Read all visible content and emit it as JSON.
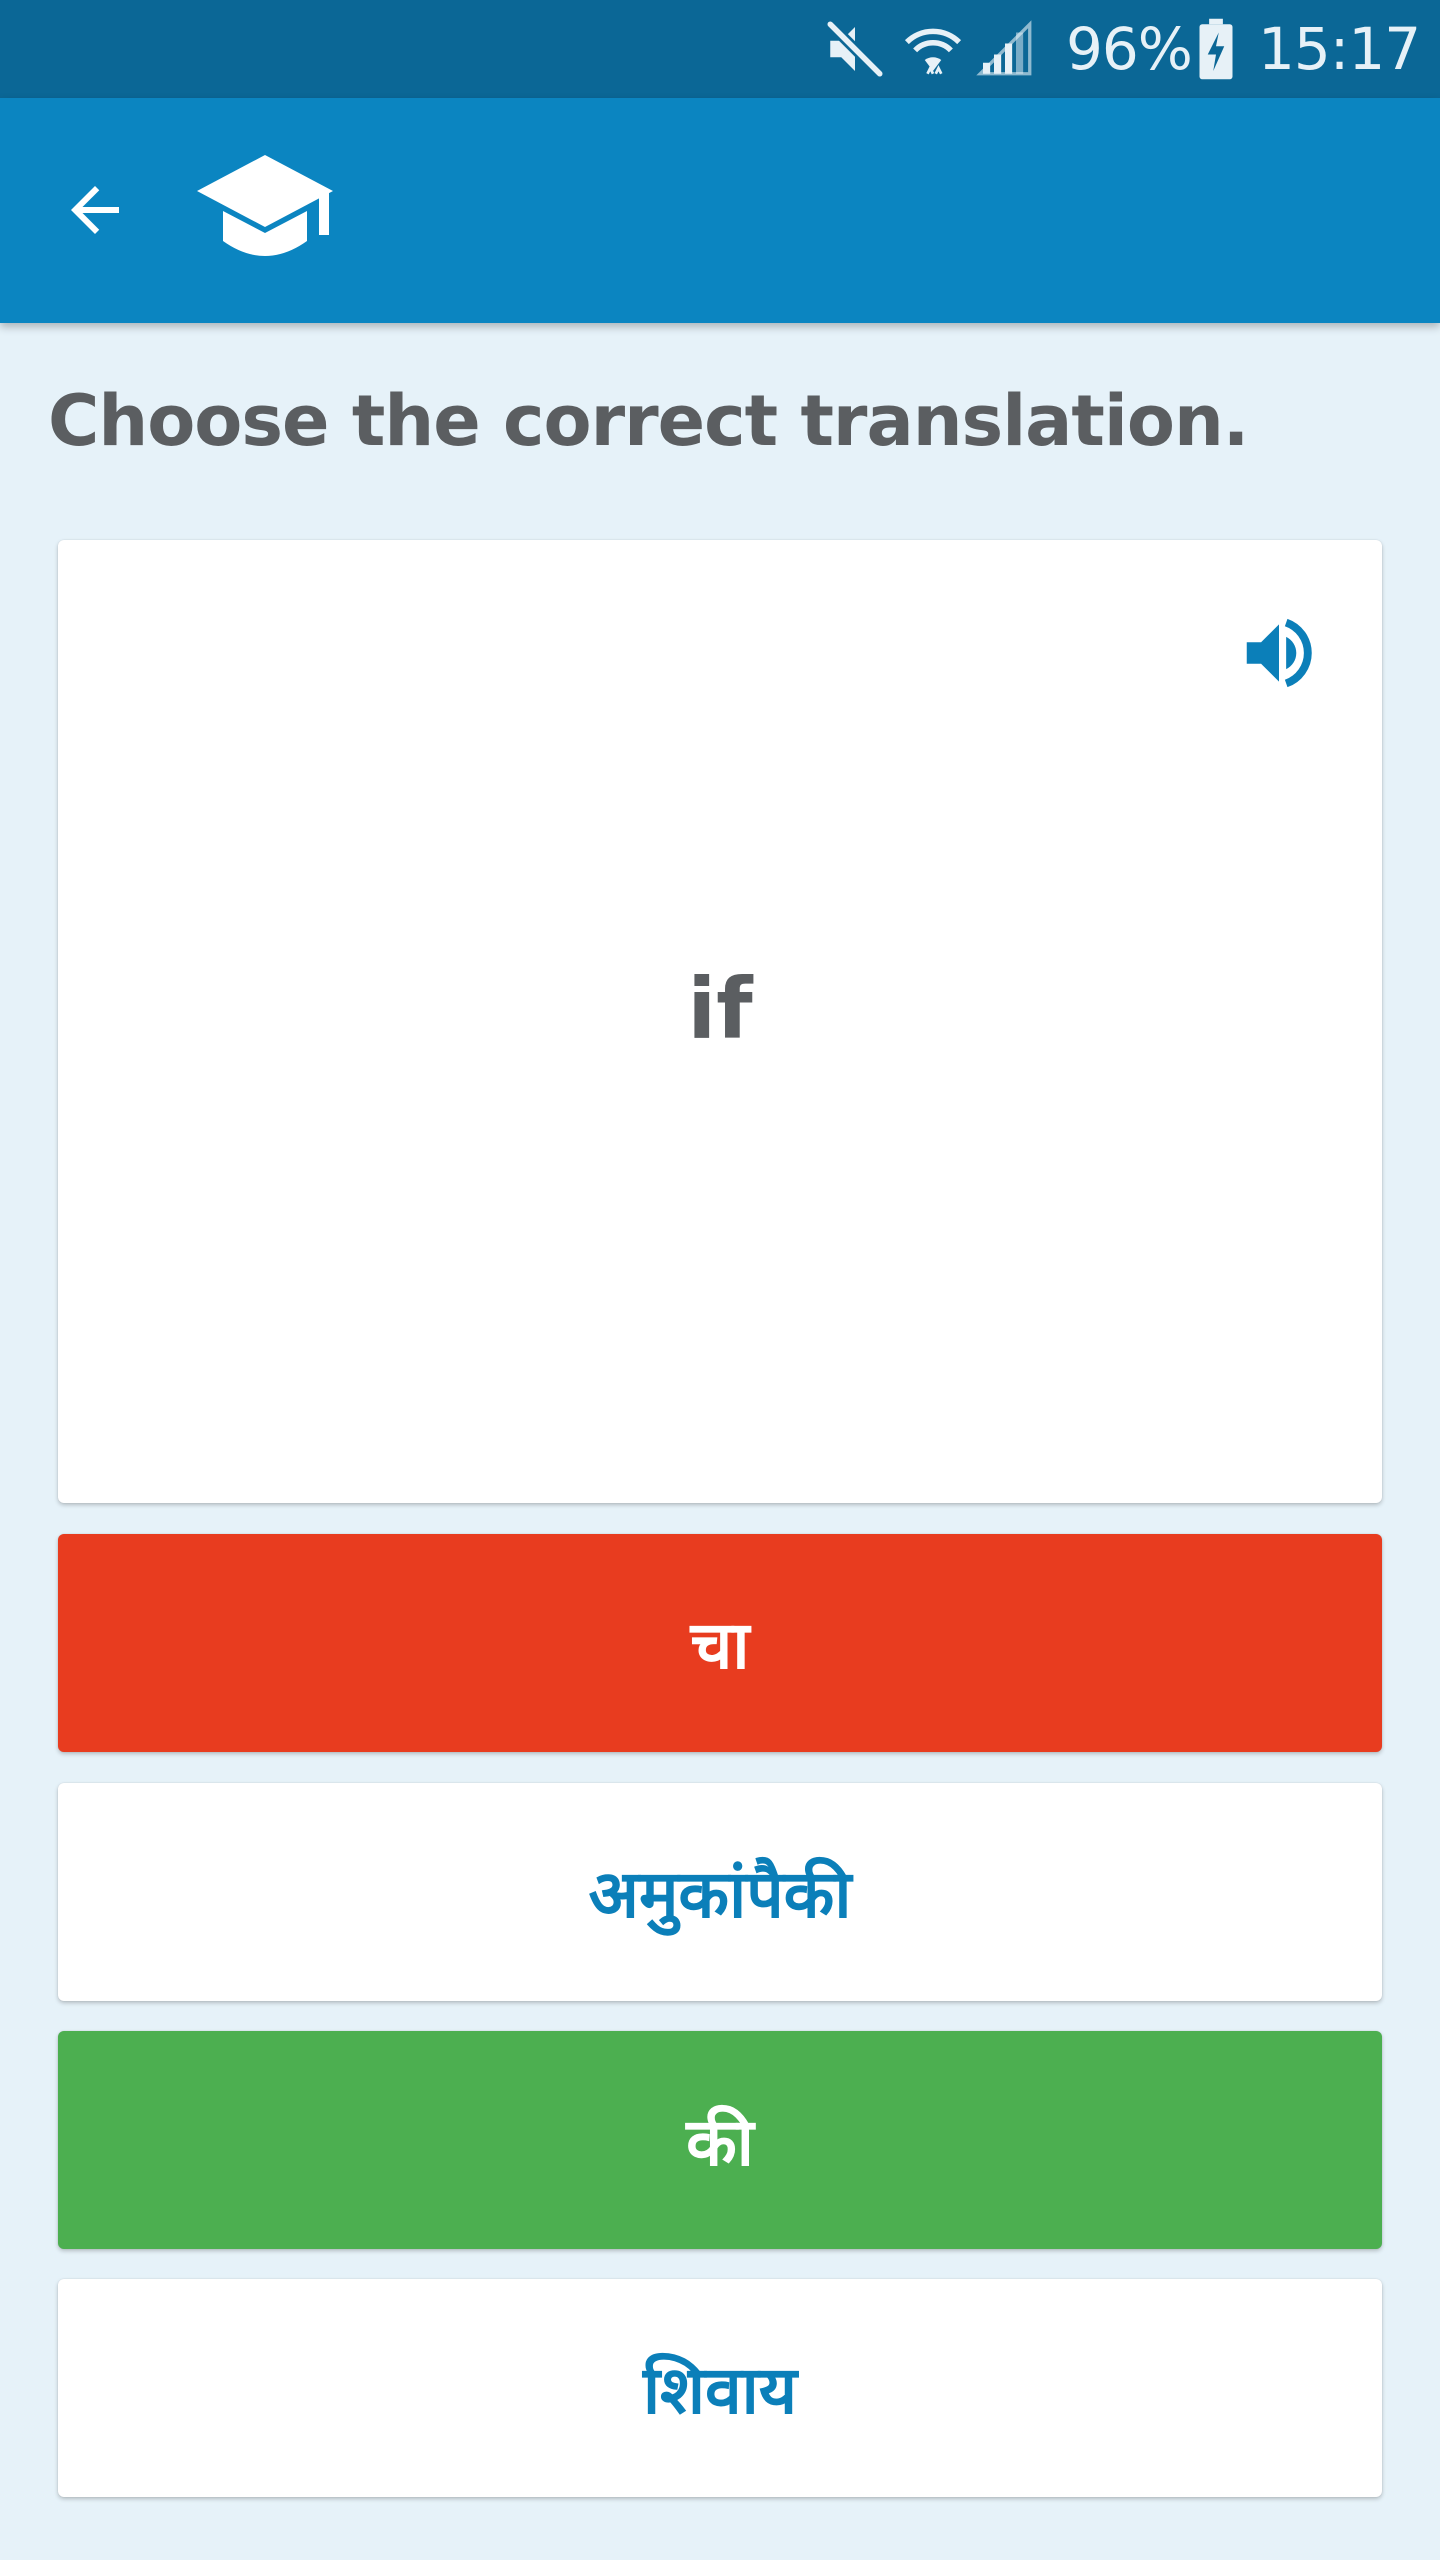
{
  "status_bar": {
    "battery": "96%",
    "time": "15:17",
    "icons": [
      "mute-icon",
      "wifi-icon",
      "signal-icon",
      "battery-charging-icon"
    ]
  },
  "app_bar": {
    "back_icon": "arrow-left-icon",
    "logo_icon": "graduation-cap-icon"
  },
  "quiz": {
    "instruction": "Choose the correct translation.",
    "prompt_word": "if",
    "speaker_icon": "speaker-icon",
    "answers": [
      {
        "label": "चा",
        "state": "wrong"
      },
      {
        "label": "अमुकांपैकी",
        "state": "neutral"
      },
      {
        "label": "की",
        "state": "correct"
      },
      {
        "label": "शिवाय",
        "state": "neutral"
      }
    ]
  },
  "colors": {
    "status_bar": "#0b6796",
    "app_bar": "#0b85c1",
    "background": "#e6f2f9",
    "wrong": "#e83c1f",
    "correct": "#4caf50",
    "accent_text": "#0b7fb9",
    "body_text": "#5b5e61"
  }
}
